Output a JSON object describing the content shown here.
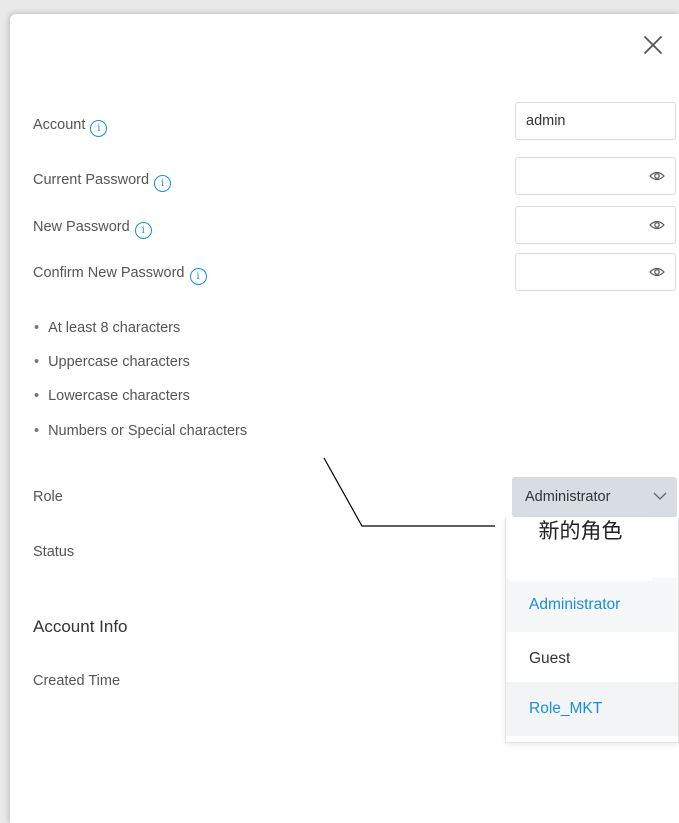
{
  "dialog": {
    "close_icon": "close-icon",
    "fields": {
      "account_label": "Account",
      "account_value": "admin",
      "current_password_label": "Current Password",
      "new_password_label": "New Password",
      "confirm_password_label": "Confirm New Password"
    },
    "password_rules": [
      "At least 8 characters",
      "Uppercase characters",
      "Lowercase characters",
      "Numbers or Special characters"
    ],
    "role_label": "Role",
    "role_selected": "Administrator",
    "status_label": "Status",
    "role_options": [
      "Administrator",
      "Guest",
      "Role_MKT"
    ],
    "annotation": "新的角色",
    "section_title": "Account Info",
    "created_time_label": "Created Time"
  },
  "colors": {
    "accent": "#1a8fd6",
    "select_bg": "#d7dde3"
  }
}
